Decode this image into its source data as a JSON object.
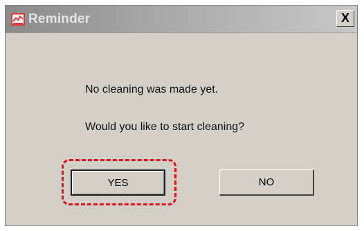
{
  "window": {
    "title": "Reminder",
    "close_label": "X"
  },
  "dialog": {
    "message_line1": "No cleaning was made yet.",
    "message_line2": "Would you like to start cleaning?"
  },
  "buttons": {
    "yes_label": "YES",
    "no_label": "NO"
  },
  "colors": {
    "dialog_background": "#d4d0c8",
    "highlight_outline": "#e0141e",
    "app_icon": "#d83a3a"
  },
  "icons": {
    "app": "reminder-app-icon",
    "close": "close-icon"
  }
}
